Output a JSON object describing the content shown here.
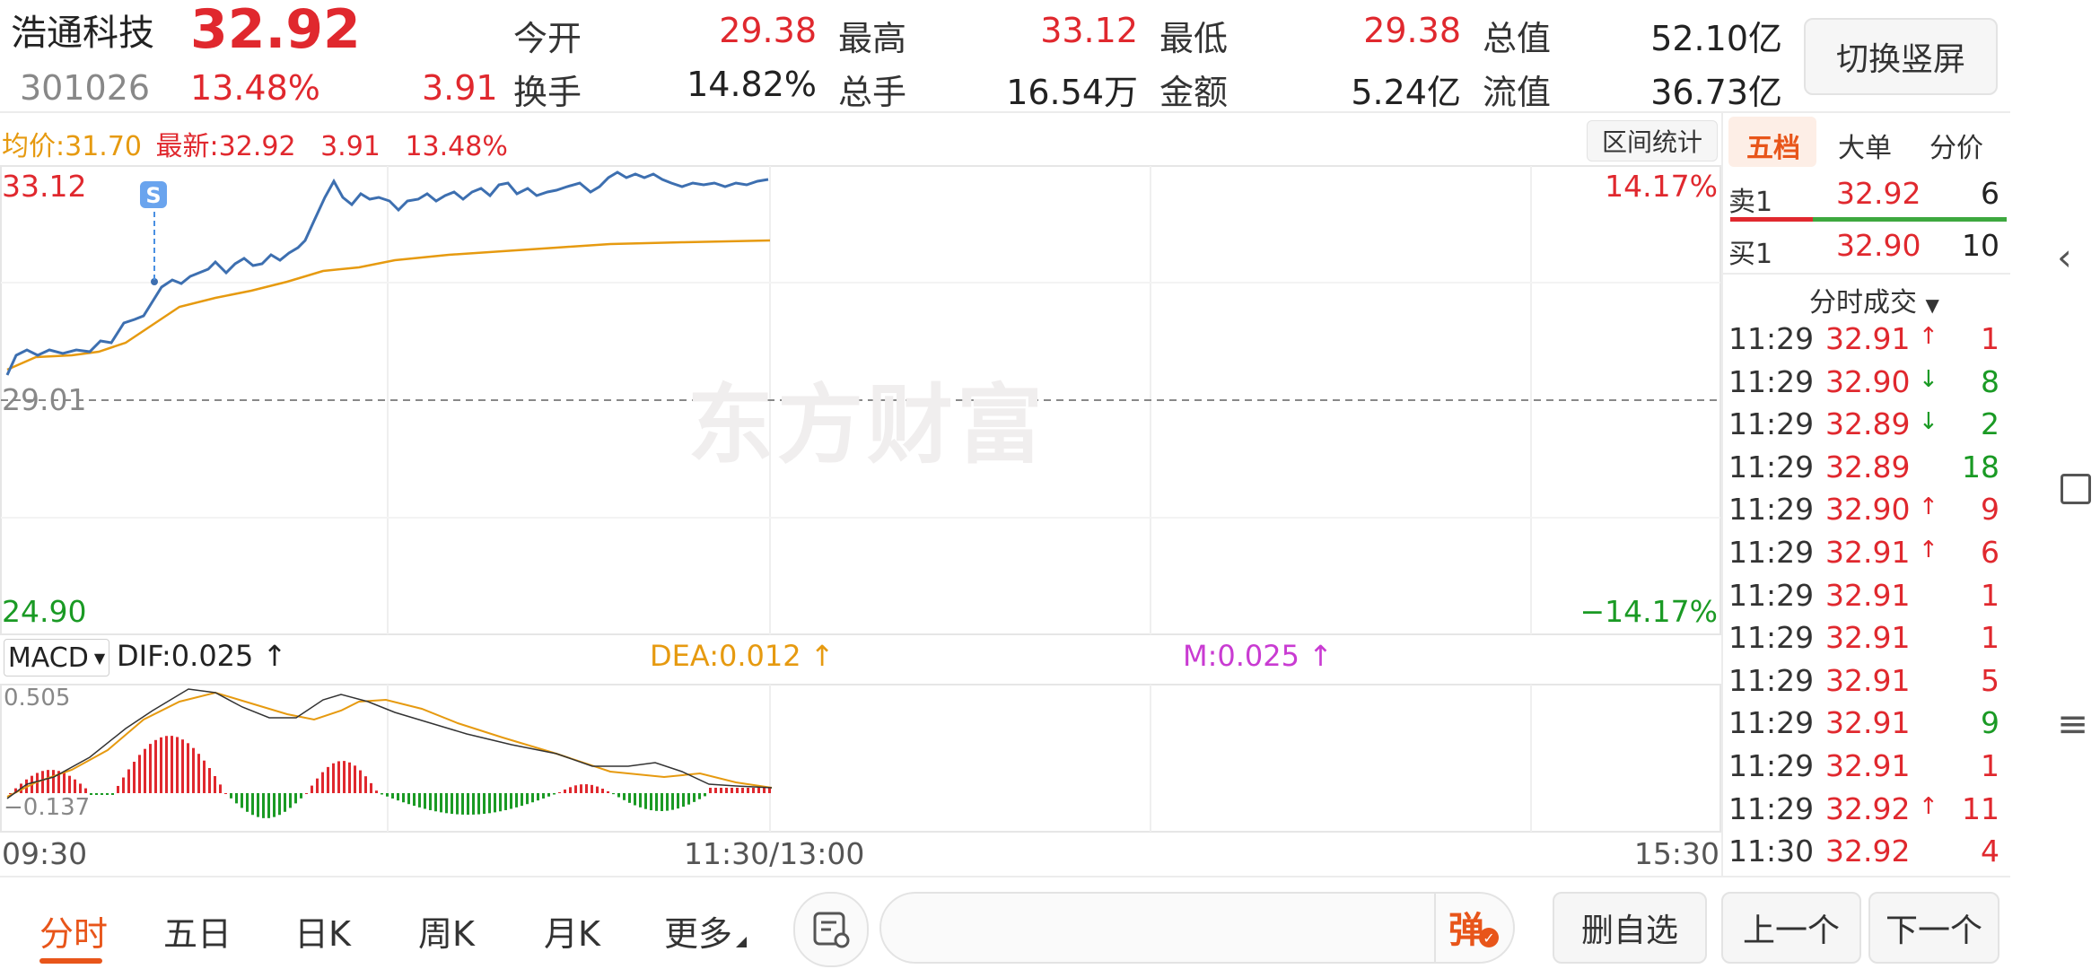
{
  "stock": {
    "name": "浩通科技",
    "price": "32.92",
    "code": "301026",
    "change_pct": "13.48%",
    "change_amt": "3.91"
  },
  "stats": [
    {
      "label": "今开",
      "value": "29.38",
      "color": "#e0282e"
    },
    {
      "label": "最高",
      "value": "33.12",
      "color": "#e0282e"
    },
    {
      "label": "最低",
      "value": "29.38",
      "color": "#e0282e"
    },
    {
      "label": "总值",
      "value": "52.10亿",
      "color": "#222222"
    },
    {
      "label": "换手",
      "value": "14.82%",
      "color": "#222222"
    },
    {
      "label": "总手",
      "value": "16.54万",
      "color": "#222222"
    },
    {
      "label": "金额",
      "value": "5.24亿",
      "color": "#222222"
    },
    {
      "label": "流值",
      "value": "36.73亿",
      "color": "#222222"
    }
  ],
  "switch_button": "切换竖屏",
  "info_line": {
    "avg_label": "均价:",
    "avg_value": "31.70",
    "latest_label": "最新:",
    "latest_value": "32.92",
    "change_amt": "3.91",
    "change_pct": "13.48%"
  },
  "range_stats_button": "区间统计",
  "chart": {
    "y_high": "33.12",
    "y_low": "24.90",
    "y_mid": "29.01",
    "pct_high": "14.17%",
    "pct_low": "−14.17%",
    "watermark": "东方财富",
    "marker": "S",
    "x_start": "09:30",
    "x_mid": "11:30/13:00",
    "x_end": "15:30"
  },
  "macd": {
    "selector": "MACD",
    "dif": "DIF:0.025",
    "dea": "DEA:0.012",
    "m": "M:0.025",
    "arrow": "↑",
    "high": "0.505",
    "low": "−0.137"
  },
  "chart_data": {
    "type": "line",
    "x_range": [
      "09:30",
      "15:30"
    ],
    "ylim": [
      24.9,
      33.12
    ],
    "pre_close": 29.01,
    "series": [],
    "macd_range": [
      -0.137,
      0.505
    ]
  },
  "right_tabs": [
    "五档",
    "大单",
    "分价"
  ],
  "orderbook": [
    {
      "label": "卖1",
      "price": "32.92",
      "vol": "6"
    },
    {
      "label": "买1",
      "price": "32.90",
      "vol": "10"
    }
  ],
  "ticks_header": "分时成交",
  "ticks": [
    {
      "time": "11:29",
      "price": "32.91",
      "arrow": "↑",
      "vol": "1",
      "vol_color": "#e0282e"
    },
    {
      "time": "11:29",
      "price": "32.90",
      "arrow": "↓",
      "vol": "8",
      "vol_color": "#1a9a24"
    },
    {
      "time": "11:29",
      "price": "32.89",
      "arrow": "↓",
      "vol": "2",
      "vol_color": "#1a9a24"
    },
    {
      "time": "11:29",
      "price": "32.89",
      "arrow": "",
      "vol": "18",
      "vol_color": "#1a9a24"
    },
    {
      "time": "11:29",
      "price": "32.90",
      "arrow": "↑",
      "vol": "9",
      "vol_color": "#e0282e"
    },
    {
      "time": "11:29",
      "price": "32.91",
      "arrow": "↑",
      "vol": "6",
      "vol_color": "#e0282e"
    },
    {
      "time": "11:29",
      "price": "32.91",
      "arrow": "",
      "vol": "1",
      "vol_color": "#e0282e"
    },
    {
      "time": "11:29",
      "price": "32.91",
      "arrow": "",
      "vol": "1",
      "vol_color": "#e0282e"
    },
    {
      "time": "11:29",
      "price": "32.91",
      "arrow": "",
      "vol": "5",
      "vol_color": "#e0282e"
    },
    {
      "time": "11:29",
      "price": "32.91",
      "arrow": "",
      "vol": "9",
      "vol_color": "#1a9a24"
    },
    {
      "time": "11:29",
      "price": "32.91",
      "arrow": "",
      "vol": "1",
      "vol_color": "#e0282e"
    },
    {
      "time": "11:29",
      "price": "32.92",
      "arrow": "↑",
      "vol": "11",
      "vol_color": "#e0282e"
    },
    {
      "time": "11:30",
      "price": "32.92",
      "arrow": "",
      "vol": "4",
      "vol_color": "#e0282e"
    }
  ],
  "bottom_tabs": [
    "分时",
    "五日",
    "日K",
    "周K",
    "月K",
    "更多"
  ],
  "danmu_button": "弹",
  "action_buttons": [
    "删自选",
    "上一个",
    "下一个"
  ],
  "colors": {
    "up": "#e0282e",
    "down": "#1a9a24",
    "price_line": "#3d6fb0",
    "avg_line": "#e69a10",
    "accent": "#e8551a"
  }
}
